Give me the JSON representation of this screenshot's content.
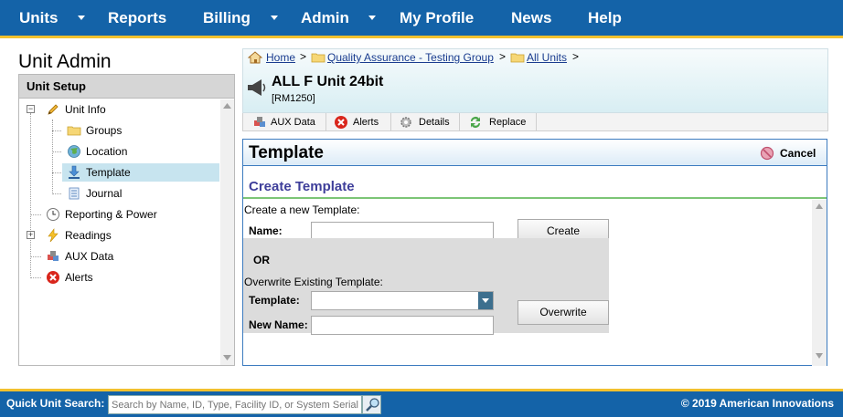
{
  "nav": {
    "items": [
      {
        "label": "Units",
        "has_menu": true
      },
      {
        "label": "Reports",
        "has_menu": false
      },
      {
        "label": "Billing",
        "has_menu": true
      },
      {
        "label": "Admin",
        "has_menu": true
      },
      {
        "label": "My Profile",
        "has_menu": false
      },
      {
        "label": "News",
        "has_menu": false
      },
      {
        "label": "Help",
        "has_menu": false
      }
    ]
  },
  "sidebar": {
    "heading": "Unit Admin",
    "panel_title": "Unit Setup",
    "tree": [
      {
        "label": "Unit Info",
        "icon": "pencil-icon",
        "expanded": true
      },
      {
        "label": "Groups",
        "icon": "folder-icon"
      },
      {
        "label": "Location",
        "icon": "globe-icon"
      },
      {
        "label": "Template",
        "icon": "download-icon",
        "selected": true
      },
      {
        "label": "Journal",
        "icon": "scroll-icon"
      },
      {
        "label": "Reporting & Power",
        "icon": "clock-icon"
      },
      {
        "label": "Readings",
        "icon": "lightning-icon",
        "expanded": false
      },
      {
        "label": "AUX Data",
        "icon": "cubes-icon"
      },
      {
        "label": "Alerts",
        "icon": "error-icon"
      }
    ]
  },
  "breadcrumb": {
    "items": [
      {
        "label": "Home",
        "icon": "home-icon"
      },
      {
        "label": "Quality Assurance - Testing Group",
        "icon": "folder-icon"
      },
      {
        "label": "All Units",
        "icon": "folder-icon"
      }
    ],
    "separator": ">"
  },
  "unit": {
    "title": "ALL F Unit 24bit",
    "code": "[RM1250]",
    "icon": "megaphone-icon"
  },
  "tabs": [
    {
      "label": "AUX Data",
      "icon": "cubes-icon"
    },
    {
      "label": "Alerts",
      "icon": "error-icon"
    },
    {
      "label": "Details",
      "icon": "gear-icon"
    },
    {
      "label": "Replace",
      "icon": "refresh-icon"
    }
  ],
  "template_panel": {
    "title": "Template",
    "cancel_label": "Cancel",
    "create_heading": "Create Template",
    "create_prompt": "Create a new Template:",
    "name_label": "Name:",
    "name_value": "",
    "create_button": "Create",
    "or_label": "OR",
    "overwrite_prompt": "Overwrite Existing Template:",
    "template_label": "Template:",
    "template_value": "",
    "new_name_label": "New Name:",
    "new_name_value": "",
    "overwrite_button": "Overwrite"
  },
  "footer": {
    "search_label": "Quick Unit Search:",
    "search_placeholder": "Search by Name, ID, Type, Facility ID, or System Serial",
    "copyright": "© 2019 American Innovations"
  }
}
